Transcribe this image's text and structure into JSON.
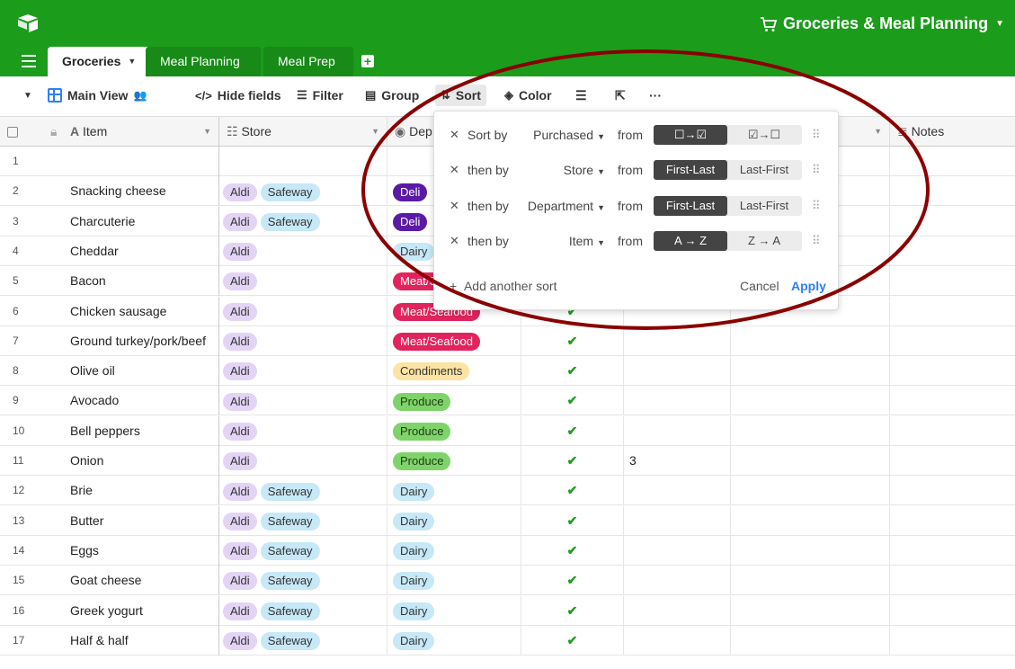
{
  "app": {
    "base_title": "Groceries & Meal Planning",
    "colors": {
      "brand": "#1b9c1b",
      "accent": "#2d7ff9",
      "check": "#1f9e1f",
      "annotation": "#8b0000"
    }
  },
  "tabs": [
    {
      "label": "Groceries",
      "active": true
    },
    {
      "label": "Meal Planning",
      "active": false
    },
    {
      "label": "Meal Prep",
      "active": false
    }
  ],
  "viewbar": {
    "view_name": "Main View",
    "hide_fields": "Hide fields",
    "filter": "Filter",
    "group": "Group",
    "sort": "Sort",
    "color": "Color"
  },
  "columns": {
    "item": "Item",
    "store": "Store",
    "dept": "Dep",
    "notes": "Notes"
  },
  "rows": [
    {
      "num": "1",
      "item": "",
      "stores": [],
      "dept": "",
      "purchased": false,
      "qty": ""
    },
    {
      "num": "2",
      "item": "Snacking cheese",
      "stores": [
        "Aldi",
        "Safeway"
      ],
      "dept": "Deli",
      "purchased": false,
      "qty": ""
    },
    {
      "num": "3",
      "item": "Charcuterie",
      "stores": [
        "Aldi",
        "Safeway"
      ],
      "dept": "Deli",
      "purchased": false,
      "qty": ""
    },
    {
      "num": "4",
      "item": "Cheddar",
      "stores": [
        "Aldi"
      ],
      "dept": "Dairy",
      "purchased": false,
      "qty": ""
    },
    {
      "num": "5",
      "item": "Bacon",
      "stores": [
        "Aldi"
      ],
      "dept": "Meat/Seafood",
      "purchased": false,
      "qty": ""
    },
    {
      "num": "6",
      "item": "Chicken sausage",
      "stores": [
        "Aldi"
      ],
      "dept": "Meat/Seafood",
      "purchased": true,
      "qty": ""
    },
    {
      "num": "7",
      "item": "Ground turkey/pork/beef",
      "stores": [
        "Aldi"
      ],
      "dept": "Meat/Seafood",
      "purchased": true,
      "qty": ""
    },
    {
      "num": "8",
      "item": "Olive oil",
      "stores": [
        "Aldi"
      ],
      "dept": "Condiments",
      "purchased": true,
      "qty": ""
    },
    {
      "num": "9",
      "item": "Avocado",
      "stores": [
        "Aldi"
      ],
      "dept": "Produce",
      "purchased": true,
      "qty": ""
    },
    {
      "num": "10",
      "item": "Bell peppers",
      "stores": [
        "Aldi"
      ],
      "dept": "Produce",
      "purchased": true,
      "qty": ""
    },
    {
      "num": "11",
      "item": "Onion",
      "stores": [
        "Aldi"
      ],
      "dept": "Produce",
      "purchased": true,
      "qty": "3"
    },
    {
      "num": "12",
      "item": "Brie",
      "stores": [
        "Aldi",
        "Safeway"
      ],
      "dept": "Dairy",
      "purchased": true,
      "qty": ""
    },
    {
      "num": "13",
      "item": "Butter",
      "stores": [
        "Aldi",
        "Safeway"
      ],
      "dept": "Dairy",
      "purchased": true,
      "qty": ""
    },
    {
      "num": "14",
      "item": "Eggs",
      "stores": [
        "Aldi",
        "Safeway"
      ],
      "dept": "Dairy",
      "purchased": true,
      "qty": ""
    },
    {
      "num": "15",
      "item": "Goat cheese",
      "stores": [
        "Aldi",
        "Safeway"
      ],
      "dept": "Dairy",
      "purchased": true,
      "qty": ""
    },
    {
      "num": "16",
      "item": "Greek yogurt",
      "stores": [
        "Aldi",
        "Safeway"
      ],
      "dept": "Dairy",
      "purchased": true,
      "qty": ""
    },
    {
      "num": "17",
      "item": "Half & half",
      "stores": [
        "Aldi",
        "Safeway"
      ],
      "dept": "Dairy",
      "purchased": true,
      "qty": ""
    }
  ],
  "pill_colors": {
    "Aldi": {
      "bg": "#e3d4f5",
      "fg": "#333333"
    },
    "Safeway": {
      "bg": "#c6e8f7",
      "fg": "#333333"
    },
    "Deli": {
      "bg": "#5b1aa6",
      "fg": "#ffffff"
    },
    "Dairy": {
      "bg": "#c6e8f7",
      "fg": "#333333"
    },
    "Meat/Seafood": {
      "bg": "#e0245e",
      "fg": "#ffffff"
    },
    "Condiments": {
      "bg": "#fbe3a3",
      "fg": "#333333"
    },
    "Produce": {
      "bg": "#7fd36b",
      "fg": "#1f3a12"
    }
  },
  "sort": {
    "rules": [
      {
        "label": "Sort by",
        "field": "Purchased",
        "from": "from",
        "opt_a": "☐→☑",
        "opt_b": "☑→☐",
        "selected": "a"
      },
      {
        "label": "then by",
        "field": "Store",
        "from": "from",
        "opt_a": "First-Last",
        "opt_b": "Last-First",
        "selected": "a"
      },
      {
        "label": "then by",
        "field": "Department",
        "from": "from",
        "opt_a": "First-Last",
        "opt_b": "Last-First",
        "selected": "a"
      },
      {
        "label": "then by",
        "field": "Item",
        "from": "from",
        "opt_a": "A → Z",
        "opt_b": "Z → A",
        "selected": "a"
      }
    ],
    "add_label": "Add another sort",
    "cancel": "Cancel",
    "apply": "Apply"
  }
}
